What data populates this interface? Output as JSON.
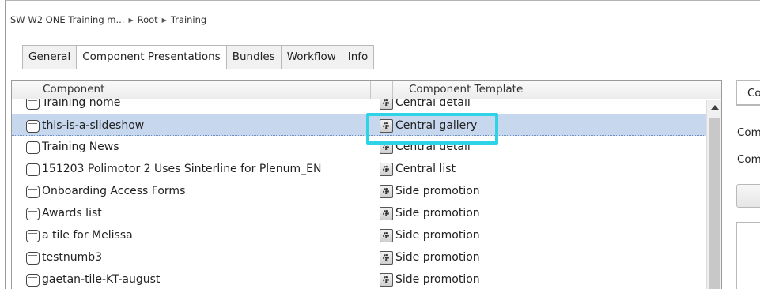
{
  "breadcrumb": {
    "items": [
      "SW W2 ONE Training m...",
      "Root",
      "Training"
    ],
    "separator": "▶"
  },
  "tabs": [
    {
      "label": "General",
      "active": false
    },
    {
      "label": "Component Presentations",
      "active": true
    },
    {
      "label": "Bundles",
      "active": false
    },
    {
      "label": "Workflow",
      "active": false
    },
    {
      "label": "Info",
      "active": false
    }
  ],
  "grid": {
    "columns": {
      "component": "Component",
      "template": "Component Template"
    },
    "rows": [
      {
        "component": "Training home",
        "template": "Central detail",
        "selected": false
      },
      {
        "component": "this-is-a-slideshow",
        "template": "Central gallery",
        "selected": true
      },
      {
        "component": "Training News",
        "template": "Central detail",
        "selected": false
      },
      {
        "component": "151203 Polimotor 2 Uses Sinterline for Plenum_EN",
        "template": "Central list",
        "selected": false
      },
      {
        "component": "Onboarding Access Forms",
        "template": "Side promotion",
        "selected": false
      },
      {
        "component": "Awards list",
        "template": "Side promotion",
        "selected": false
      },
      {
        "component": "a tile for Melissa",
        "template": "Side promotion",
        "selected": false
      },
      {
        "component": "testnumb3",
        "template": "Side promotion",
        "selected": false
      },
      {
        "component": "gaetan-tile-KT-august",
        "template": "Side promotion",
        "selected": false
      }
    ]
  },
  "right_panel": {
    "tab_label": "Co",
    "labels": [
      "Com",
      "Com"
    ]
  },
  "colors": {
    "selection": "#c6d7ee",
    "highlight": "#2fd3e6"
  }
}
